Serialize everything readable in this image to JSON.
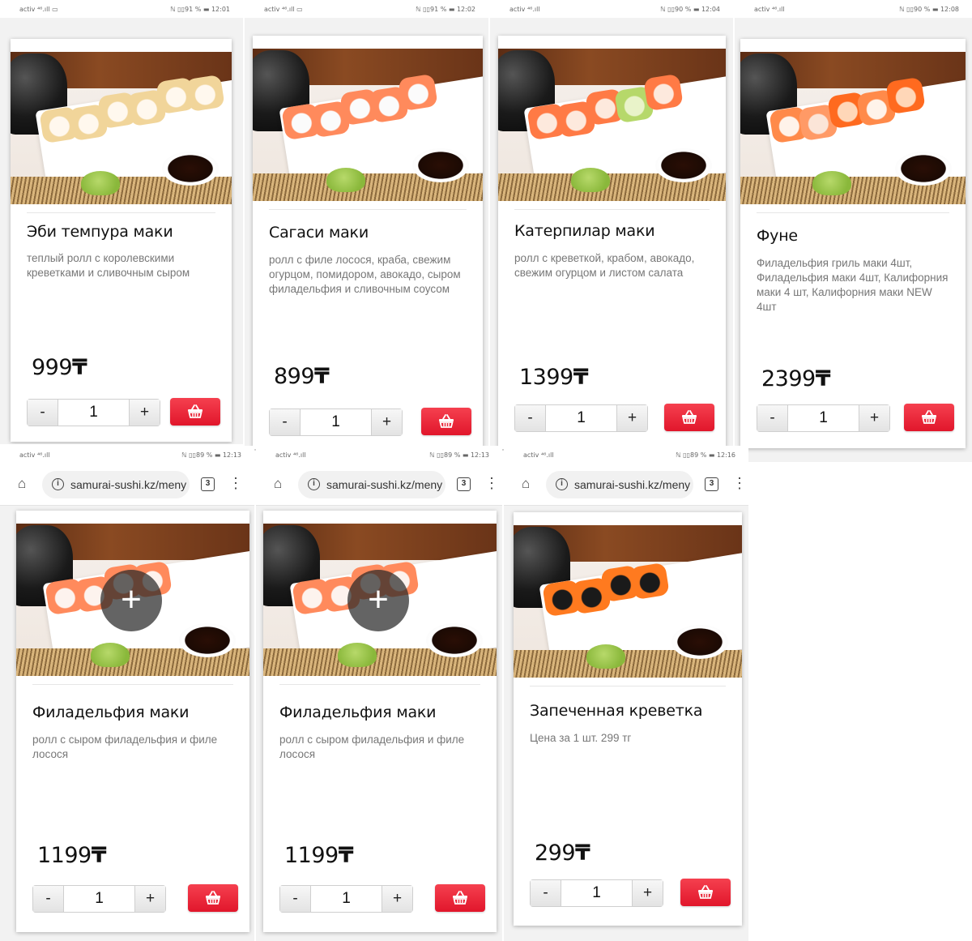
{
  "currency_symbol": "₸",
  "cart_icon": "basket-icon",
  "accent_color": "#e8202f",
  "url_bar": {
    "url": "samurai-sushi.kz/meny",
    "tab_count": "3"
  },
  "panels": [
    {
      "status": {
        "network": "activ ⁴⁶.ıll ▭",
        "system": "ℕ ▯▯91 % ▬ 12:01"
      },
      "card": {
        "title": "Эби темпура маки",
        "description": "теплый ролл с королевскими креветками и сливочным сыром",
        "price": "999",
        "quantity": "1",
        "minus": "-",
        "plus": "+"
      }
    },
    {
      "status": {
        "network": "activ ⁴⁶.ıll ▭",
        "system": "ℕ ▯▯91 % ▬ 12:02"
      },
      "card": {
        "title": "Сагаси маки",
        "description": "ролл с филе лосося, краба, свежим огурцом, помидором, авокадо, сыром филадельфия и сливочным соусом",
        "price": "899",
        "quantity": "1",
        "minus": "-",
        "plus": "+"
      }
    },
    {
      "status": {
        "network": "activ ⁴⁶.ıll",
        "system": "ℕ ▯▯90 % ▬ 12:04"
      },
      "card": {
        "title": "Катерпилар маки",
        "description": "ролл с креветкой, крабом, авокадо, свежим огурцом и листом салата",
        "price": "1399",
        "quantity": "1",
        "minus": "-",
        "plus": "+"
      }
    },
    {
      "status": {
        "network": "activ ⁴⁶.ıll",
        "system": "ℕ ▯▯90 % ▬ 12:08"
      },
      "card": {
        "title": "Фуне",
        "description": "Филадельфия гриль маки 4шт, Филадельфия маки 4шт, Калифорния маки 4 шт, Калифорния маки NEW 4шт",
        "price": "2399",
        "quantity": "1",
        "minus": "-",
        "plus": "+"
      }
    },
    {
      "status": {
        "network": "activ ⁴⁶.ıll",
        "system": "ℕ ▯▯89 % ▬ 12:13"
      },
      "card": {
        "title": "Филадельфия маки",
        "description": "ролл с сыром филадельфия и филе лосося",
        "price": "1199",
        "quantity": "1",
        "minus": "-",
        "plus": "+",
        "overlay": "+"
      }
    },
    {
      "status": {
        "network": "activ ⁴⁶.ıll",
        "system": "ℕ ▯▯89 % ▬ 12:13"
      },
      "card": {
        "title": "Филадельфия маки",
        "description": "ролл с сыром филадельфия и филе лосося",
        "price": "1199",
        "quantity": "1",
        "minus": "-",
        "plus": "+",
        "overlay": "+"
      }
    },
    {
      "status": {
        "network": "activ ⁴⁶.ıll",
        "system": "ℕ ▯▯89 % ▬ 12:16"
      },
      "card": {
        "title": "Запеченная креветка",
        "description": "Цена за 1 шт. 299 тг",
        "price": "299",
        "quantity": "1",
        "minus": "-",
        "plus": "+"
      }
    }
  ]
}
